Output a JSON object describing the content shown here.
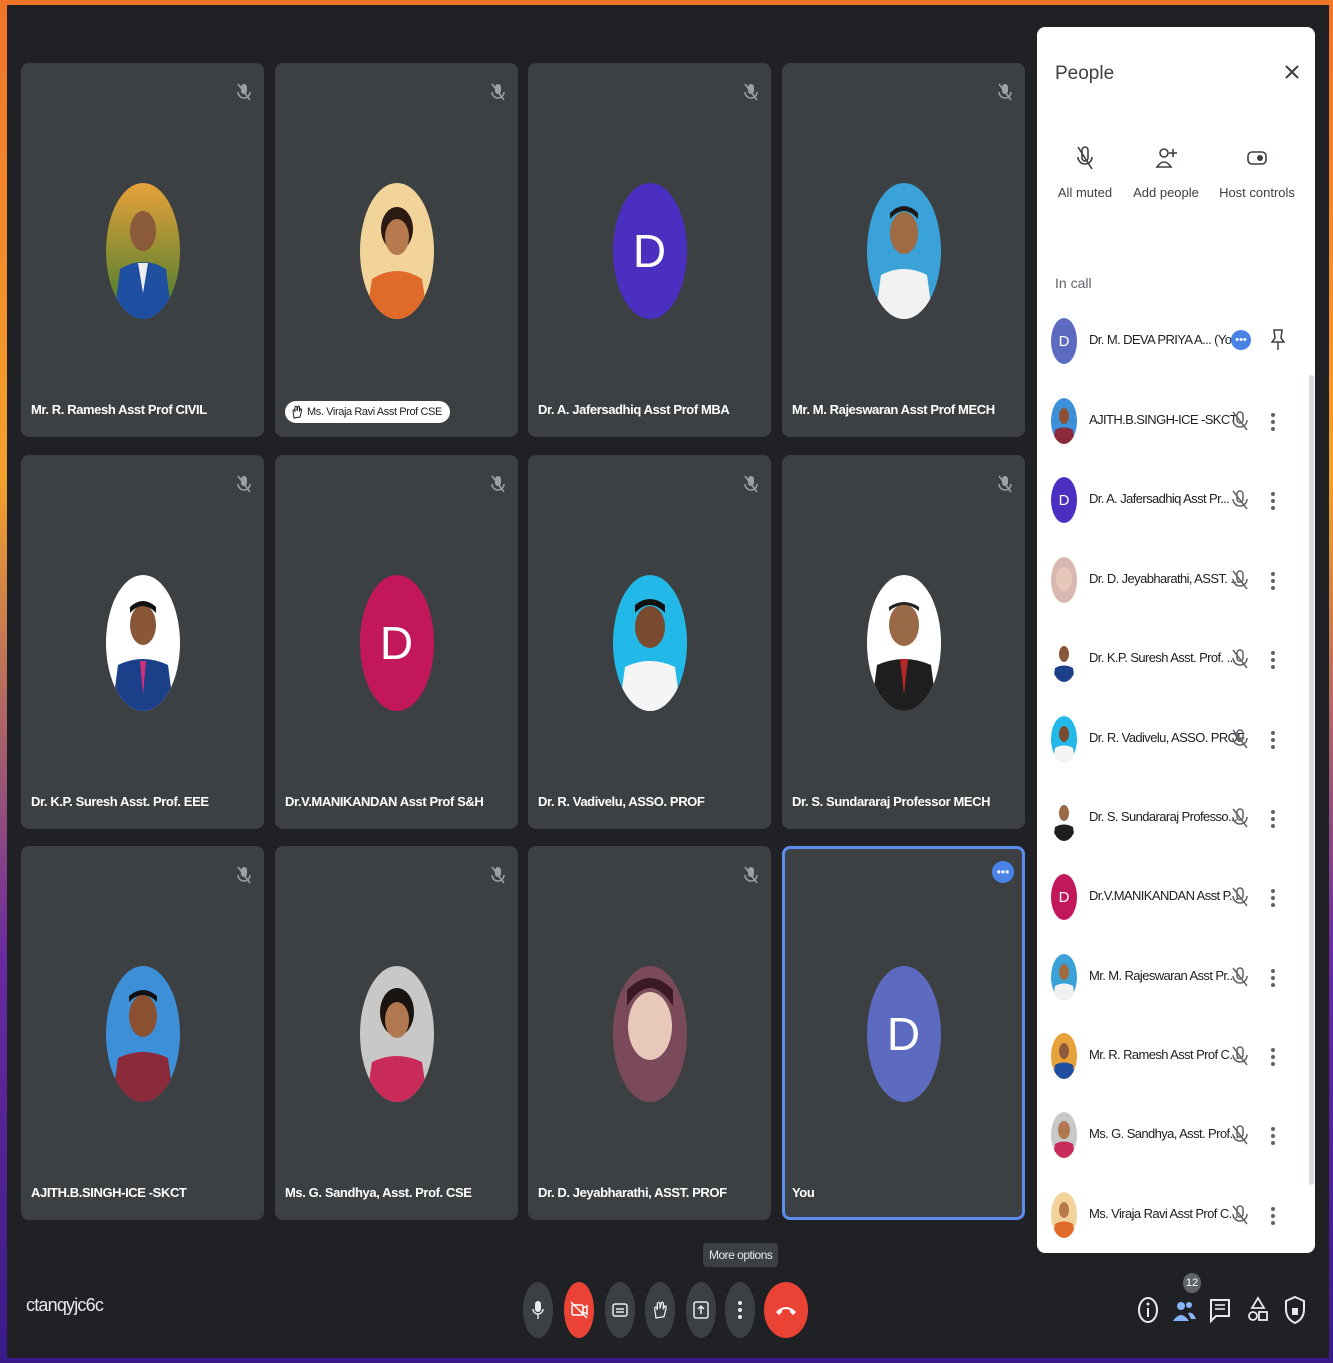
{
  "meeting": {
    "code": "ctanqyjc6c",
    "tooltip": "More options",
    "participant_count": "12"
  },
  "tiles": [
    {
      "name": "Mr. R. Ramesh Asst Prof CIVIL"
    },
    {
      "name": "Ms. Viraja Ravi Asst Prof CSE"
    },
    {
      "name": "Dr. A. Jafersadhiq Asst Prof MBA",
      "letter": "D"
    },
    {
      "name": "Mr. M. Rajeswaran Asst Prof MECH"
    },
    {
      "name": "Dr. K.P. Suresh Asst. Prof. EEE"
    },
    {
      "name": "Dr.V.MANIKANDAN Asst Prof S&H",
      "letter": "D"
    },
    {
      "name": "Dr. R. Vadivelu, ASSO. PROF"
    },
    {
      "name": "Dr. S. Sundararaj Professor MECH"
    },
    {
      "name": "AJITH.B.SINGH-ICE -SKCT"
    },
    {
      "name": "Ms. G. Sandhya, Asst. Prof. CSE"
    },
    {
      "name": "Dr. D. Jeyabharathi, ASST. PROF"
    },
    {
      "name": "You",
      "letter": "D",
      "more": "•••"
    }
  ],
  "people_panel": {
    "title": "People",
    "actions": [
      {
        "label": "All muted"
      },
      {
        "label": "Add people"
      },
      {
        "label": "Host controls"
      }
    ],
    "section": "In call",
    "participants": [
      {
        "name": "Dr. M. DEVA PRIYA A... (You)",
        "letter": "D",
        "more": "•••"
      },
      {
        "name": "AJITH.B.SINGH-ICE -SKCT"
      },
      {
        "name": "Dr. A. Jafersadhiq Asst Pr...",
        "letter": "D"
      },
      {
        "name": "Dr. D. Jeyabharathi, ASST. ..."
      },
      {
        "name": "Dr. K.P. Suresh Asst. Prof. ..."
      },
      {
        "name": "Dr. R. Vadivelu, ASSO. PROF"
      },
      {
        "name": "Dr. S. Sundararaj Professo..."
      },
      {
        "name": "Dr.V.MANIKANDAN Asst P...",
        "letter": "D"
      },
      {
        "name": "Mr. M. Rajeswaran Asst Pr..."
      },
      {
        "name": "Mr. R. Ramesh Asst Prof C..."
      },
      {
        "name": "Ms. G. Sandhya, Asst. Prof..."
      },
      {
        "name": "Ms. Viraja Ravi Asst Prof C..."
      }
    ]
  },
  "colors": {
    "background": "#202124",
    "tile": "#3c4043",
    "accent_blue": "#4a82e8",
    "end_call_red": "#ea4335",
    "avatar_purple": "#4a2fc0",
    "avatar_magenta": "#c2185b",
    "avatar_you": "#5c6bc0"
  },
  "icons": {
    "tile_mute": "mic-off-icon",
    "raised_hand": "hand-icon",
    "controls": [
      "mic-icon",
      "camera-off-icon",
      "captions-icon",
      "raise-hand-icon",
      "present-icon",
      "more-options-icon",
      "end-call-icon"
    ],
    "right_controls": [
      "info-icon",
      "people-icon",
      "chat-icon",
      "activities-icon",
      "host-controls-icon"
    ]
  }
}
